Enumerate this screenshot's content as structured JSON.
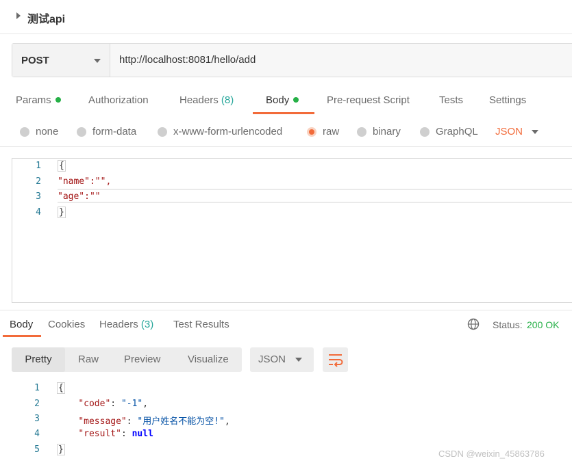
{
  "request": {
    "name": "测试api",
    "method": "POST",
    "url": "http://localhost:8081/hello/add"
  },
  "request_tabs": [
    {
      "label": "Params",
      "dot": true
    },
    {
      "label": "Authorization"
    },
    {
      "label": "Headers",
      "count": "(8)"
    },
    {
      "label": "Body",
      "dot": true,
      "active": true
    },
    {
      "label": "Pre-request Script"
    },
    {
      "label": "Tests"
    },
    {
      "label": "Settings"
    }
  ],
  "body_types": [
    {
      "label": "none"
    },
    {
      "label": "form-data"
    },
    {
      "label": "x-www-form-urlencoded"
    },
    {
      "label": "raw",
      "selected": true
    },
    {
      "label": "binary"
    },
    {
      "label": "GraphQL"
    }
  ],
  "raw_format": "JSON",
  "request_editor": {
    "line_numbers": [
      "1",
      "2",
      "3",
      "4"
    ],
    "lines": [
      "{",
      "\"name\":\"\",",
      "\"age\":\"\"",
      "}"
    ]
  },
  "response": {
    "tabs": [
      {
        "label": "Body",
        "active": true
      },
      {
        "label": "Cookies"
      },
      {
        "label": "Headers",
        "count": "(3)"
      },
      {
        "label": "Test Results"
      }
    ],
    "status_label": "Status:",
    "status_value": "200 OK",
    "view_modes": [
      "Pretty",
      "Raw",
      "Preview",
      "Visualize"
    ],
    "format": "JSON",
    "line_numbers": [
      "1",
      "2",
      "3",
      "4",
      "5"
    ],
    "body": {
      "open": "{",
      "code_key": "\"code\"",
      "code_val": "\"-1\"",
      "message_key": "\"message\"",
      "message_val": "\"用户姓名不能为空!\"",
      "result_key": "\"result\"",
      "result_val": "null",
      "close": "}"
    }
  },
  "watermark": "CSDN @weixin_45863786",
  "colors": {
    "accent": "#f26b3a",
    "success": "#26b047",
    "count": "#26a69a"
  }
}
